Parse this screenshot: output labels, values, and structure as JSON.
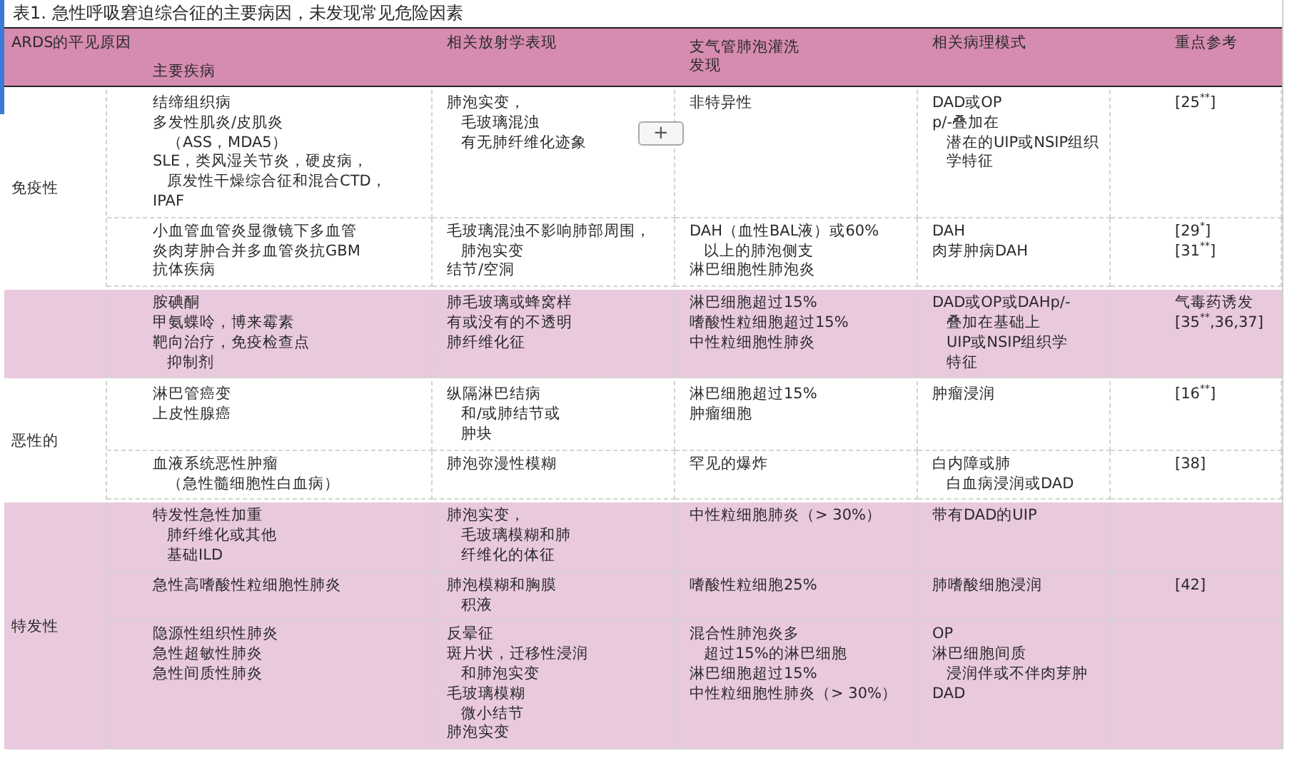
{
  "title": "表1. 急性呼吸窘迫综合征的主要病因，未发现常见危险因素",
  "header": {
    "cause": "ARDS的平见原因",
    "disease": "主要疾病",
    "radiology": "相关放射学表现",
    "bal": [
      "支气管肺泡灌洗",
      "发现"
    ],
    "pathology": "相关病理模式",
    "reference": "重点参考"
  },
  "add_button": {
    "label": "+"
  },
  "sections": [
    {
      "group": "免疫性",
      "shaded": false,
      "rows": [
        {
          "disease": [
            [
              "结缔组织病"
            ],
            [
              "多发性肌炎/皮肌炎",
              "（ASS，MDA5）"
            ],
            [
              "SLE，类风湿关节炎，硬皮病，",
              "原发性干燥综合征和混合CTD，"
            ],
            [
              "IPAF"
            ]
          ],
          "radiology": [
            [
              "肺泡实变，",
              "毛玻璃混浊",
              "有无肺纤维化迹象"
            ]
          ],
          "bal": [
            [
              "非特异性"
            ]
          ],
          "pathology": [
            [
              "DAD或OP"
            ],
            [
              "p/-叠加在",
              "潜在的UIP或NSIP组织",
              "学特征"
            ]
          ],
          "reference": [
            [
              "[25$^{**}$]"
            ]
          ]
        },
        {
          "disease": [
            [
              "小血管血管炎显微镜下多血管"
            ],
            [
              "炎肉芽肿合并多血管炎抗GBM"
            ],
            [
              "抗体疾病"
            ]
          ],
          "radiology": [
            [
              "毛玻璃混浊不影响肺部周围，",
              "肺泡实变"
            ],
            [
              "结节/空洞"
            ]
          ],
          "bal": [
            [
              "DAH（血性BAL液）或60%",
              "以上的肺泡侧支"
            ],
            [
              "淋巴细胞性肺泡炎"
            ]
          ],
          "pathology": [
            [
              "DAH"
            ],
            [
              "肉芽肿病DAH"
            ]
          ],
          "reference": [
            [
              "[29$^{*}$]"
            ],
            [
              "[31$^{**}$]"
            ]
          ]
        }
      ]
    },
    {
      "shaded": true,
      "rows": [
        {
          "disease": [
            [
              "胺碘酮"
            ],
            [
              "甲氨蝶呤，博来霉素"
            ],
            [
              "靶向治疗，免疫检查点",
              "抑制剂"
            ]
          ],
          "radiology": [
            [
              "肺毛玻璃或蜂窝样"
            ],
            [
              "有或没有的不透明"
            ],
            [
              "肺纤维化征"
            ]
          ],
          "bal": [
            [
              "淋巴细胞超过15%"
            ],
            [
              "嗜酸性粒细胞超过15%"
            ],
            [
              "中性粒细胞性肺炎"
            ]
          ],
          "pathology": [
            [
              "DAD或OP或DAHp/-",
              "叠加在基础上",
              "UIP或NSIP组织学",
              "特征"
            ]
          ],
          "reference": [
            [
              "气毒药诱发"
            ],
            [
              "[35$^{**}$,36,37]"
            ]
          ]
        }
      ]
    },
    {
      "group": "恶性的",
      "shaded": false,
      "rows": [
        {
          "disease": [
            [
              "淋巴管癌变"
            ],
            [
              "上皮性腺癌"
            ]
          ],
          "radiology": [
            [
              "纵隔淋巴结病",
              "和/或肺结节或",
              "肿块"
            ]
          ],
          "bal": [
            [
              "淋巴细胞超过15%"
            ],
            [
              "肿瘤细胞"
            ]
          ],
          "pathology": [
            [
              "肿瘤浸润"
            ]
          ],
          "reference": [
            [
              "[16$^{**}$]"
            ]
          ]
        },
        {
          "disease": [
            [
              "血液系统恶性肿瘤",
              "（急性髓细胞性白血病）"
            ]
          ],
          "radiology": [
            [
              "肺泡弥漫性模糊"
            ]
          ],
          "bal": [
            [
              "罕见的爆炸"
            ]
          ],
          "pathology": [
            [
              "白内障或肺",
              "白血病浸润或DAD"
            ]
          ],
          "reference": [
            [
              "[38]"
            ]
          ]
        }
      ]
    },
    {
      "group": "特发性",
      "shaded": true,
      "rows": [
        {
          "disease": [
            [
              "特发性急性加重",
              "肺纤维化或其他",
              "基础ILD"
            ]
          ],
          "radiology": [
            [
              "肺泡实变，",
              "毛玻璃模糊和肺",
              "纤维化的体征"
            ]
          ],
          "bal": [
            [
              "中性粒细胞肺炎（> 30%）"
            ]
          ],
          "pathology": [
            [
              "带有DAD的UIP"
            ]
          ],
          "reference": []
        },
        {
          "disease": [
            [
              "急性高嗜酸性粒细胞性肺炎"
            ]
          ],
          "radiology": [
            [
              "肺泡模糊和胸膜",
              "积液"
            ]
          ],
          "bal": [
            [
              "嗜酸性粒细胞25%"
            ]
          ],
          "pathology": [
            [
              "肺嗜酸细胞浸润"
            ]
          ],
          "reference": [
            [
              "[42]"
            ]
          ]
        },
        {
          "disease": [
            [
              "隐源性组织性肺炎"
            ],
            [
              "急性超敏性肺炎"
            ],
            [
              "急性间质性肺炎"
            ]
          ],
          "radiology": [
            [
              "反晕征"
            ],
            [
              "斑片状，迁移性浸润",
              "和肺泡实变"
            ],
            [
              "毛玻璃模糊",
              "微小结节"
            ],
            [
              "肺泡实变"
            ]
          ],
          "bal": [
            [
              "混合性肺泡炎多",
              "超过15%的淋巴细胞"
            ],
            [
              "淋巴细胞超过15%"
            ],
            [
              "中性粒细胞性肺炎（> 30%）"
            ]
          ],
          "pathology": [
            [
              "OP"
            ],
            [
              "淋巴细胞间质",
              "浸润伴或不伴肉芽肿"
            ],
            [
              "DAD"
            ]
          ],
          "reference": []
        }
      ]
    }
  ]
}
